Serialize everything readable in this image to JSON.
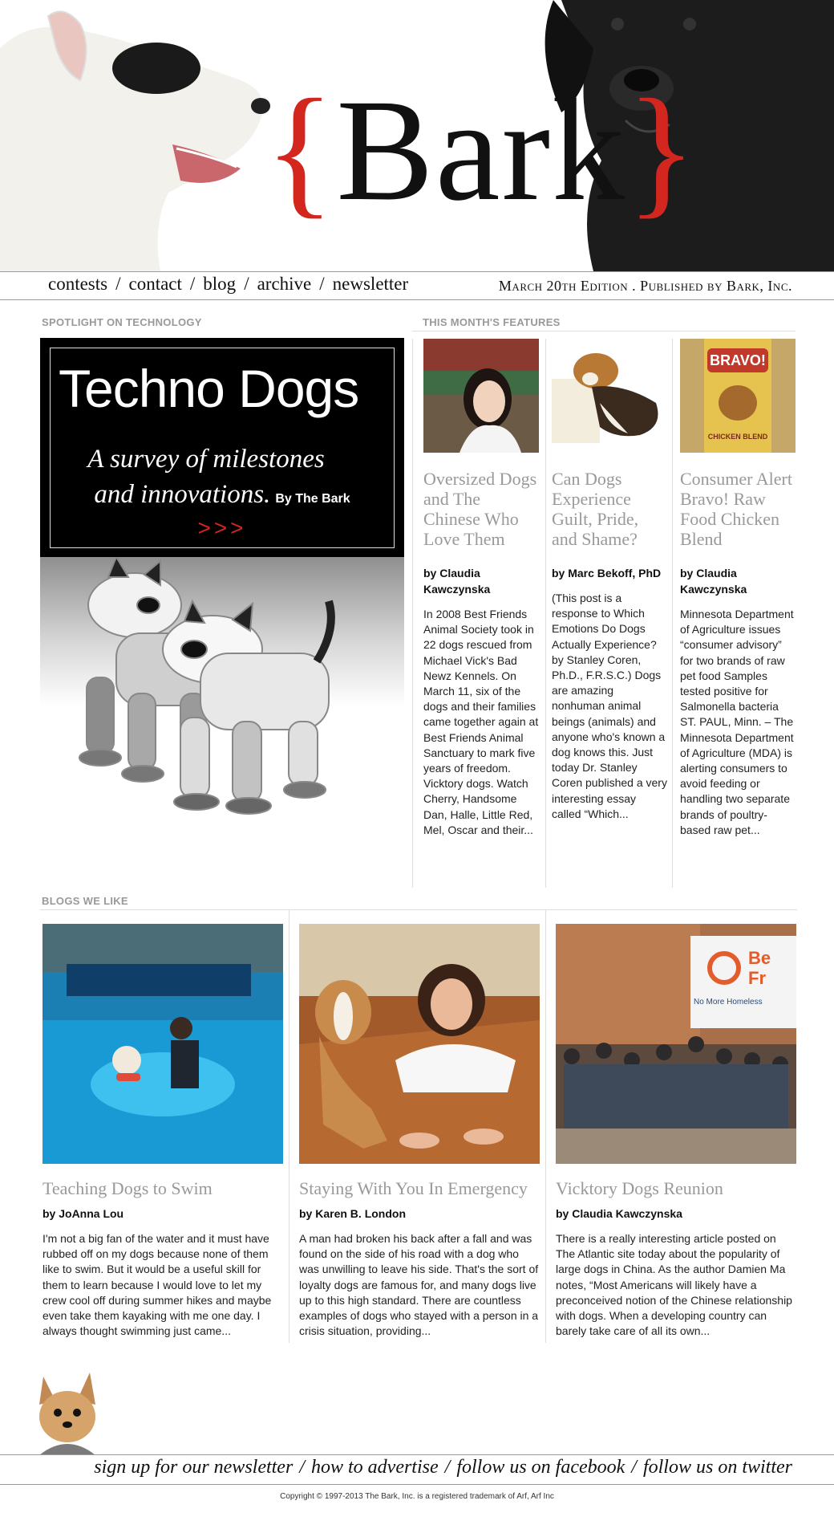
{
  "header": {
    "logo_brace_open": "{",
    "logo_text": "Bark",
    "logo_brace_close": "}",
    "nav": [
      "contests",
      "contact",
      "blog",
      "archive",
      "newsletter"
    ],
    "nav_separator": "/",
    "edition": "March 20th Edition . Published by Bark, Inc."
  },
  "spotlight": {
    "section_label": "SPOTLIGHT ON TECHNOLOGY",
    "title": "Techno Dogs",
    "subtitle_line1": "A survey of milestones",
    "subtitle_line2": "and innovations.",
    "byline": "By The Bark",
    "arrows": ">>>"
  },
  "features": {
    "section_label": "THIS MONTH'S FEATURES",
    "items": [
      {
        "title": "Oversized Dogs and The Chinese Who Love Them",
        "author": "by Claudia Kawczynska",
        "body": "In 2008 Best Friends Animal Society took in 22 dogs rescued from Michael Vick's Bad Newz Kennels. On March 11, six of the dogs and their families came together again at Best Friends Animal Sanctuary to mark five years of freedom. Vicktory dogs. Watch Cherry, Handsome Dan, Halle, Little Red, Mel, Oscar and their..."
      },
      {
        "title": "Can Dogs Experience Guilt, Pride, and Shame?",
        "author": "by Marc Bekoff, PhD",
        "body": "(This post is a response to Which Emotions Do Dogs Actually Experience? by Stanley Coren, Ph.D., F.R.S.C.) Dogs are amazing nonhuman animal beings (animals) and anyone who's known a dog knows this. Just today Dr. Stanley Coren published a very interesting essay called “Which..."
      },
      {
        "title": "Consumer Alert Bravo! Raw Food Chicken Blend",
        "author": "by Claudia Kawczynska",
        "body": "Minnesota Department of Agriculture issues “consumer advisory” for two brands of raw pet food Samples tested positive for Salmonella bacteria ST. PAUL, Minn. – The Minnesota Department of Agriculture (MDA) is alerting consumers to avoid feeding or handling two separate brands of poultry-based raw pet..."
      }
    ]
  },
  "blogs": {
    "section_label": "BLOGS WE LIKE",
    "items": [
      {
        "title": "Teaching Dogs to Swim",
        "author": "by JoAnna Lou",
        "body": "I'm not a big fan of the water and it must have rubbed off on my dogs because none of them like to swim. But it would be a useful skill for them to learn because I would love to let my crew cool off during summer hikes and maybe even take them kayaking with me one day. I always thought swimming just came..."
      },
      {
        "title": "Staying With You In Emergency",
        "author": "by Karen B. London",
        "body": "A man had broken his back after a fall and was found on the side of his road with a dog who was unwilling to leave his side. That's the sort of loyalty dogs are famous for, and many dogs live up to this high standard. There are countless examples of dogs who stayed with a person in a crisis situation, providing..."
      },
      {
        "title": "Vicktory Dogs Reunion",
        "author": "by Claudia Kawczynska",
        "body": "There is a really interesting article posted on The Atlantic  site today about the popularity of large dogs in China. As the author Damien Ma notes, “Most Americans will likely have a preconceived notion of the Chinese relationship with dogs. When a developing country can barely take care of all its own..."
      }
    ],
    "sign_text": "No More Homeless",
    "bravo_label": "BRAVO!",
    "bravo_sub": "CHICKEN BLEND"
  },
  "footer": {
    "links": [
      "sign up for our newsletter",
      "how to advertise",
      "follow us on facebook",
      "follow us on twitter"
    ],
    "separator": "/",
    "copyright": "Copyright © 1997-2013 The Bark, Inc. is a registered trademark of Arf, Arf Inc"
  },
  "colors": {
    "accent_red": "#d3261f",
    "muted_gray": "#999999"
  }
}
